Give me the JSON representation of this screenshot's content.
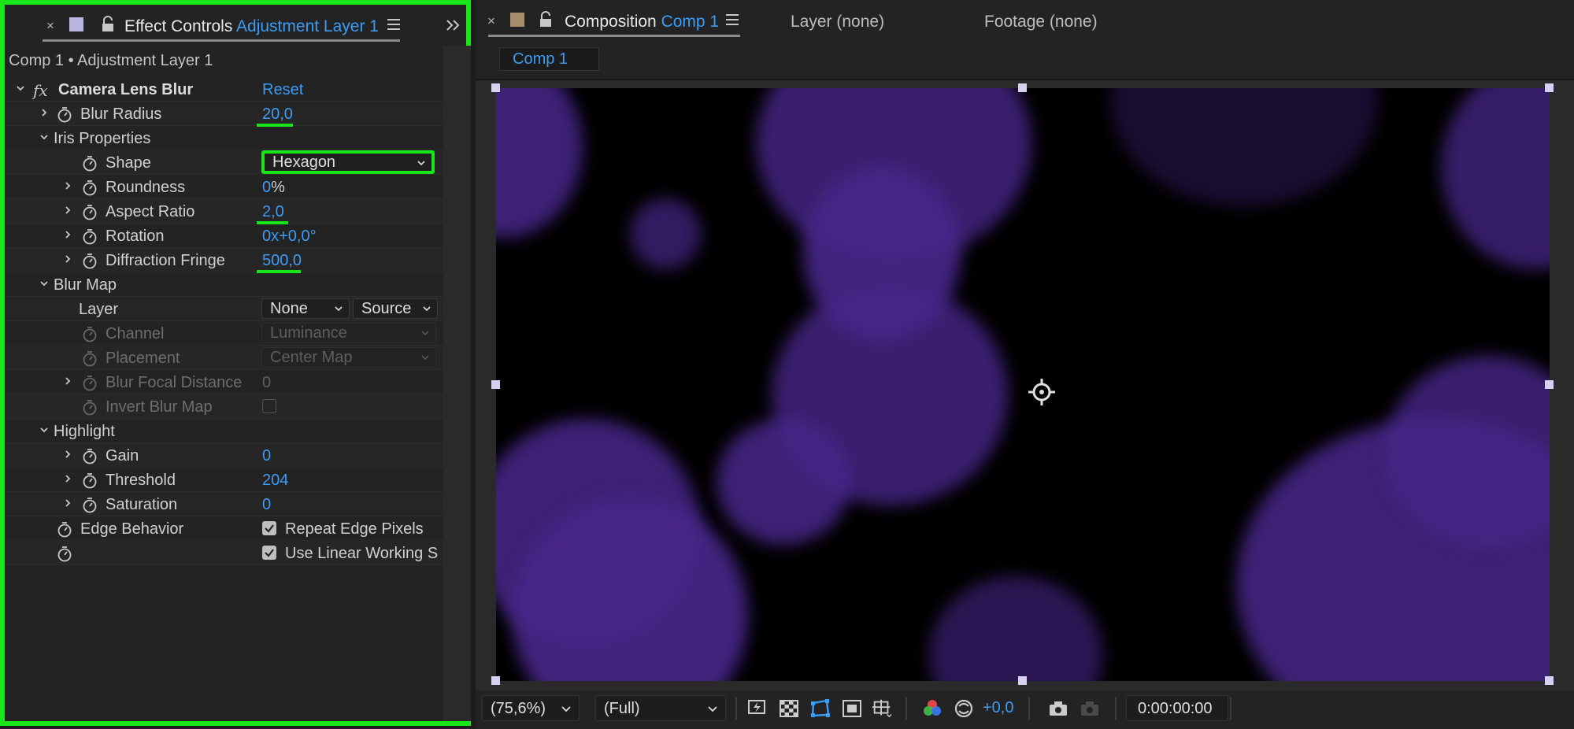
{
  "effect_controls": {
    "tab_title": "Effect Controls",
    "tab_layer": "Adjustment Layer 1",
    "subheader": "Comp 1 • Adjustment Layer 1",
    "effect": {
      "fx_label": "fx",
      "name": "Camera Lens Blur",
      "reset_label": "Reset"
    },
    "blur_radius": {
      "label": "Blur Radius",
      "value": "20,0"
    },
    "iris": {
      "label": "Iris Properties",
      "shape": {
        "label": "Shape",
        "value": "Hexagon"
      },
      "roundness": {
        "label": "Roundness",
        "value": "0",
        "unit": "%"
      },
      "aspect_ratio": {
        "label": "Aspect Ratio",
        "value": "2,0"
      },
      "rotation": {
        "label": "Rotation",
        "value": "0x+0,0°"
      },
      "diffraction": {
        "label": "Diffraction Fringe",
        "value": "500,0"
      }
    },
    "blur_map": {
      "label": "Blur Map",
      "layer": {
        "label": "Layer",
        "value": "None",
        "source": "Source"
      },
      "channel": {
        "label": "Channel",
        "value": "Luminance"
      },
      "placement": {
        "label": "Placement",
        "value": "Center Map"
      },
      "focal": {
        "label": "Blur Focal Distance",
        "value": "0"
      },
      "invert": {
        "label": "Invert Blur Map"
      }
    },
    "highlight": {
      "label": "Highlight",
      "gain": {
        "label": "Gain",
        "value": "0"
      },
      "threshold": {
        "label": "Threshold",
        "value": "204"
      },
      "saturation": {
        "label": "Saturation",
        "value": "0"
      }
    },
    "edge": {
      "label": "Edge Behavior",
      "checkbox_label": "Repeat Edge Pixels"
    },
    "linear": {
      "checkbox_label": "Use Linear Working S"
    }
  },
  "composition": {
    "tab_title": "Composition",
    "tab_comp": "Comp 1",
    "layer_tab": "Layer (none)",
    "footage_tab": "Footage (none)",
    "subtab": "Comp 1",
    "zoom": "(75,6%)",
    "resolution": "(Full)",
    "exposure": "+0,0",
    "timecode": "0:00:00:00"
  },
  "colors": {
    "accent": "#3b9cf5",
    "highlight_outline": "#19e619",
    "bokeh": "#48278a"
  }
}
